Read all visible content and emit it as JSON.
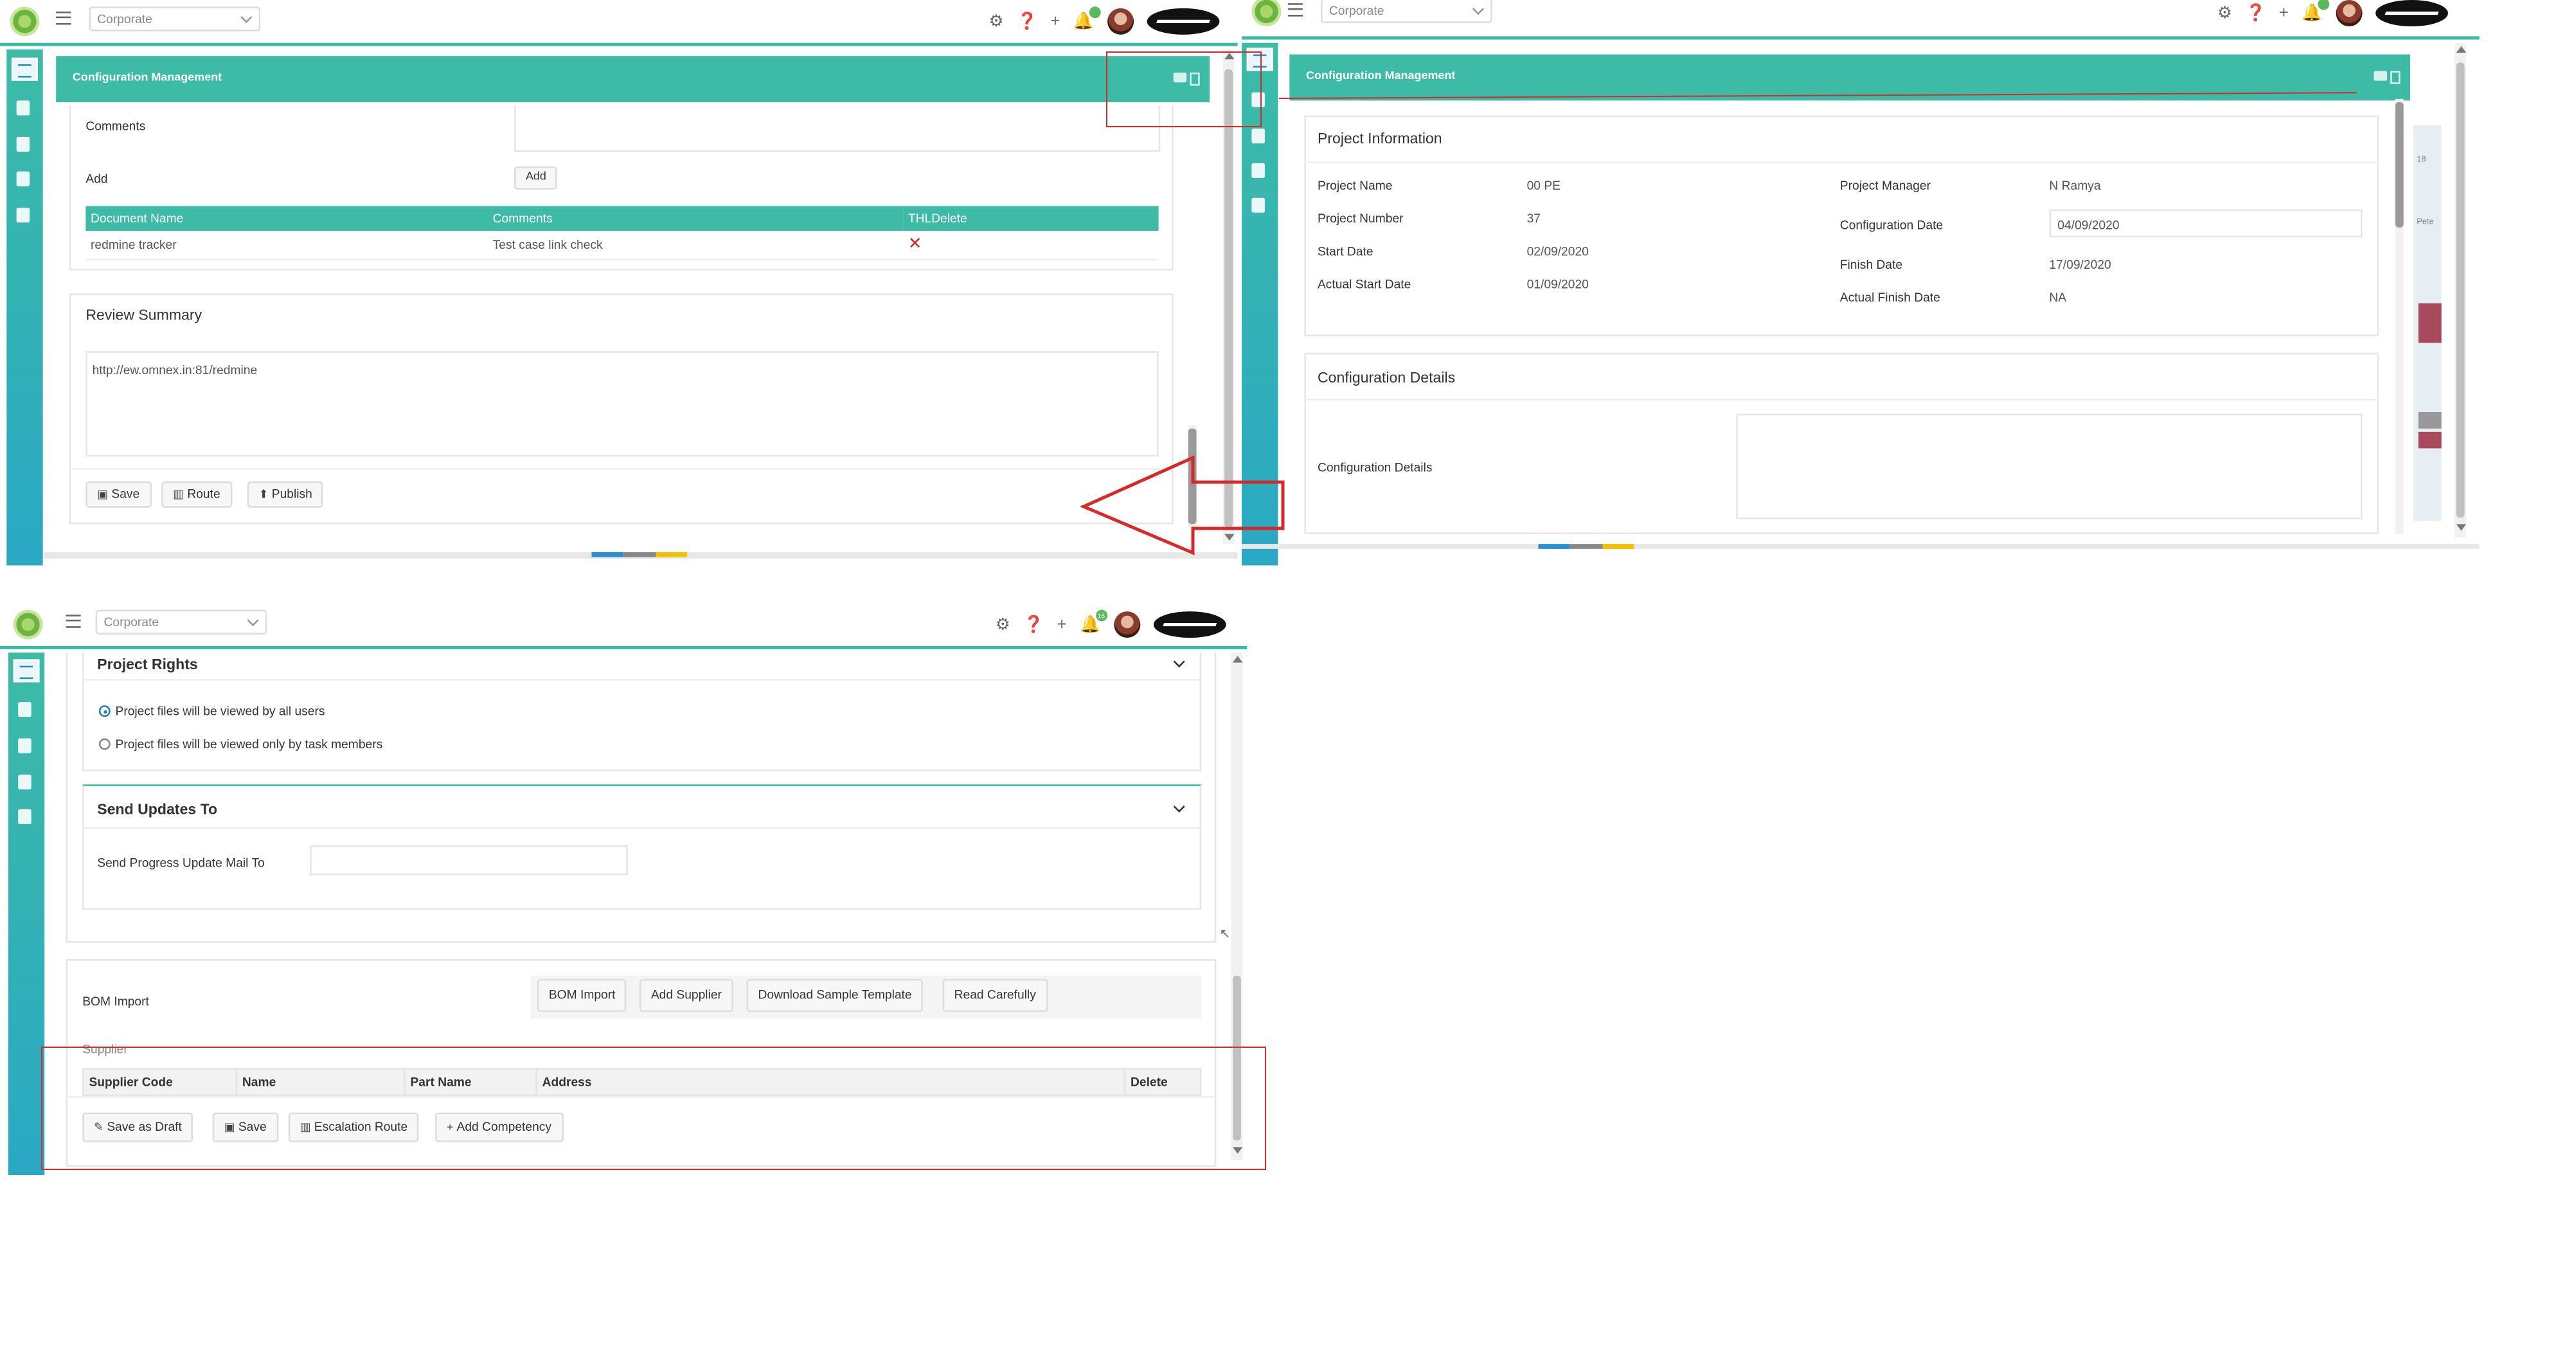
{
  "topbar": {
    "org_select": "Corporate",
    "icons": [
      "gear-icon",
      "help-icon",
      "plus-icon",
      "bell-icon",
      "avatar",
      "company-logo"
    ],
    "notification_count_3": "16"
  },
  "panel1": {
    "header_title": "Configuration Management",
    "comments_label": "Comments",
    "add_label": "Add",
    "add_button": "Add",
    "table": {
      "headers": [
        "Document Name",
        "Comments",
        "THLDelete"
      ],
      "rows": [
        {
          "document_name": "redmine tracker",
          "comments": "Test case link check",
          "delete": "✕"
        }
      ]
    },
    "review_summary_title": "Review Summary",
    "review_summary_text": "http://ew.omnex.in:81/redmine",
    "buttons": {
      "save": "Save",
      "route": "Route",
      "publish": "Publish"
    }
  },
  "panel2": {
    "header_title": "Configuration Management",
    "project_info_title": "Project Information",
    "fields": {
      "project_name_label": "Project Name",
      "project_name": "00 PE",
      "project_number_label": "Project Number",
      "project_number": "37",
      "start_date_label": "Start Date",
      "start_date": "02/09/2020",
      "actual_start_date_label": "Actual Start Date",
      "actual_start_date": "01/09/2020",
      "project_manager_label": "Project Manager",
      "project_manager": "N Ramya",
      "configuration_date_label": "Configuration Date",
      "configuration_date": "04/09/2020",
      "finish_date_label": "Finish Date",
      "finish_date": "17/09/2020",
      "actual_finish_date_label": "Actual Finish Date",
      "actual_finish_date": "NA"
    },
    "config_details_title": "Configuration Details",
    "config_details_label": "Configuration Details",
    "side_text_1": "18",
    "side_text_2": "Pete"
  },
  "panel3": {
    "project_rights_title": "Project Rights",
    "radio_all": "Project files will be viewed by all users",
    "radio_task": "Project files will be viewed only by task members",
    "send_updates_title": "Send Updates To",
    "send_progress_label": "Send Progress Update Mail To",
    "bom_import_label": "BOM Import",
    "bom_buttons": {
      "bom_import": "BOM Import",
      "add_supplier": "Add Supplier",
      "download_template": "Download Sample Template",
      "read_carefully": "Read Carefully"
    },
    "supplier_label": "Supplier",
    "supplier_headers": [
      "Supplier Code",
      "Name",
      "Part Name",
      "Address",
      "Delete"
    ],
    "buttons": {
      "save_as_draft": "Save as Draft",
      "save": "Save",
      "escalation_route": "Escalation Route",
      "add_competency": "Add Competency"
    }
  }
}
